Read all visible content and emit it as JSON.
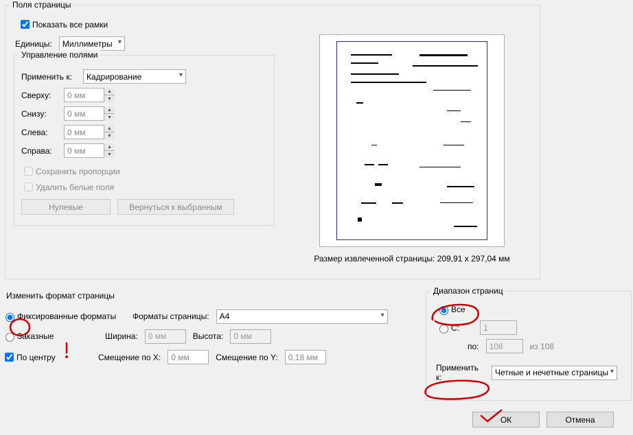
{
  "page_fields": {
    "title": "Поля страницы",
    "show_all_frames": "Показать все рамки",
    "units_label": "Единицы:",
    "units_value": "Миллиметры",
    "margins": {
      "title": "Управление полями",
      "apply_to_label": "Применить к:",
      "apply_to_value": "Кадрирование",
      "top_label": "Сверху:",
      "top_value": "0 мм",
      "bottom_label": "Снизу:",
      "bottom_value": "0 мм",
      "left_label": "Слева:",
      "left_value": "0 мм",
      "right_label": "Справа:",
      "right_value": "0 мм",
      "lock_proportions": "Сохранить пропорции",
      "remove_white": "Удалить белые поля",
      "zero_btn": "Нулевые",
      "revert_btn": "Вернуться к выбранным"
    },
    "preview_label": "Размер извлеченной страницы: 209,91 x 297,04 мм"
  },
  "resize": {
    "title": "Изменить формат страницы",
    "fixed_label": "Фиксированные форматы",
    "custom_label": "Заказные",
    "formats_label": "Форматы страницы:",
    "format_value": "A4",
    "width_label": "Ширина:",
    "width_value": "0 мм",
    "height_label": "Высота:",
    "height_value": "0 мм",
    "center_label": "По центру",
    "offset_x_label": "Смещение по X:",
    "offset_x_value": "0 мм",
    "offset_y_label": "Смещение по Y:",
    "offset_y_value": "0,18 мм"
  },
  "range": {
    "title": "Диапазон страниц",
    "all_label": "Все",
    "from_label": "С:",
    "from_value": "1",
    "to_label": "по:",
    "to_value": "108",
    "of_label": "из 108",
    "apply_to_label": "Применить к:",
    "apply_to_value": "Четные и нечетные страницы"
  },
  "buttons": {
    "ok": "ОК",
    "cancel": "Отмена"
  }
}
